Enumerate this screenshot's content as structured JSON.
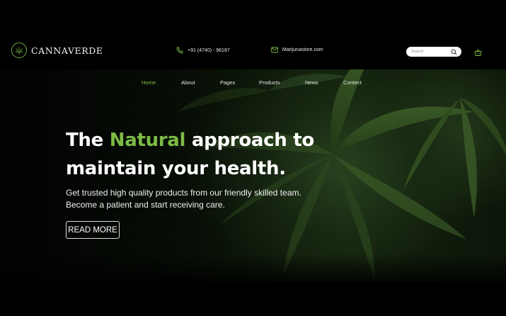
{
  "brand": {
    "name": "CANNAVERDE",
    "icon": "cannabis-leaf-icon",
    "accent": "#7dbb45"
  },
  "header": {
    "phone": {
      "icon": "phone-icon",
      "text": "+91 (4740) - 96187"
    },
    "email": {
      "icon": "mail-icon",
      "text": "Marijunastore.com"
    },
    "search": {
      "placeholder": "Search",
      "icon": "search-icon"
    },
    "cart_icon": "basket-icon"
  },
  "nav": {
    "items": [
      {
        "label": "Home",
        "active": true
      },
      {
        "label": "About"
      },
      {
        "label": "Pages"
      },
      {
        "label": "Products"
      },
      {
        "label": "News"
      },
      {
        "label": "Contect"
      }
    ]
  },
  "hero": {
    "headline_pre": "The ",
    "headline_accent": "Natural",
    "headline_post": " approach to",
    "headline_line2": "maintain your health.",
    "sub_line1": "Get trusted high quality products from our friendly skilled team.",
    "sub_line2": "Become a patient and start receiving care.",
    "cta": "READ MORE"
  }
}
